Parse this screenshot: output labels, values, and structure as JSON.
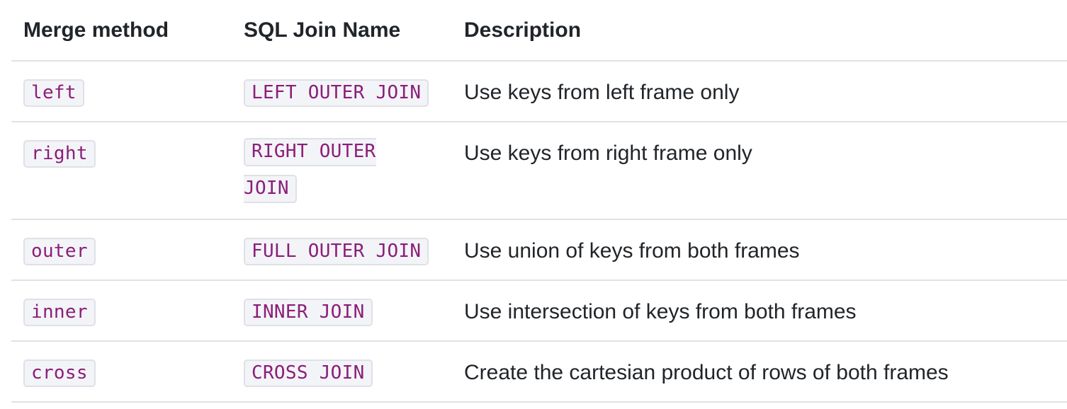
{
  "table": {
    "headers": {
      "merge_method": "Merge method",
      "sql_join_name": "SQL Join Name",
      "description": "Description"
    },
    "rows": [
      {
        "method": "left",
        "sql": "LEFT OUTER JOIN",
        "description": "Use keys from left frame only"
      },
      {
        "method": "right",
        "sql": "RIGHT OUTER JOIN",
        "description": "Use keys from right frame only"
      },
      {
        "method": "outer",
        "sql": "FULL OUTER JOIN",
        "description": "Use union of keys from both frames"
      },
      {
        "method": "inner",
        "sql": "INNER JOIN",
        "description": "Use intersection of keys from both frames"
      },
      {
        "method": "cross",
        "sql": "CROSS JOIN",
        "description": "Create the cartesian product of rows of both frames"
      }
    ]
  },
  "colors": {
    "code_text": "#8b1e7a",
    "code_background": "#f3f4f7",
    "border": "#dee2e6",
    "text": "#212529"
  }
}
